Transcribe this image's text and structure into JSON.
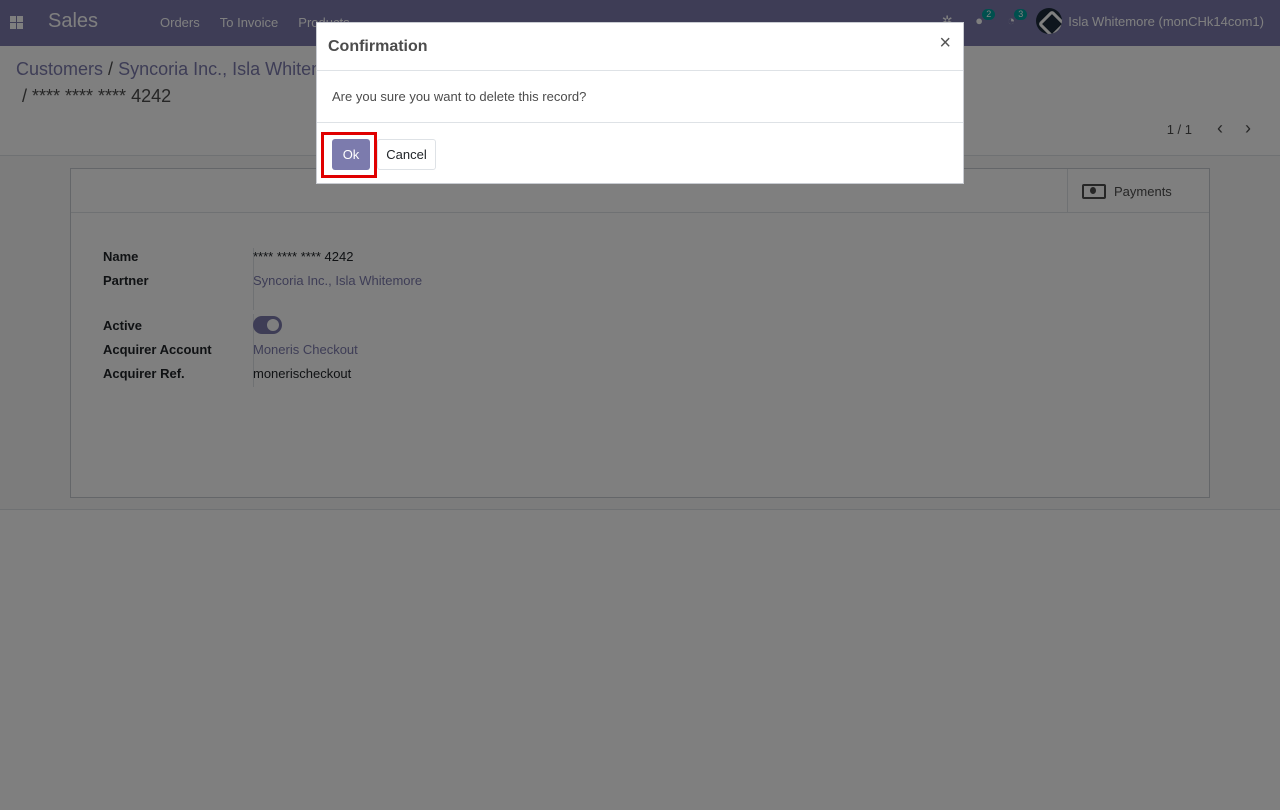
{
  "navbar": {
    "app_title": "Sales",
    "menu": [
      "Orders",
      "To Invoice",
      "Products"
    ],
    "messages_count": "2",
    "activities_count": "3",
    "user_name": "Isla Whitemore (monCHk14com1)"
  },
  "breadcrumb": {
    "items": [
      "Customers",
      "Syncoria Inc., Isla Whitemore"
    ],
    "separator": "/",
    "current": "/ **** **** **** 4242"
  },
  "pager": {
    "value": "1 / 1"
  },
  "sheet": {
    "payments_label": "Payments",
    "fields": {
      "name_label": "Name",
      "name_value": "**** **** **** 4242",
      "partner_label": "Partner",
      "partner_value": "Syncoria Inc., Isla Whitemore",
      "active_label": "Active",
      "active_value": true,
      "acquirer_label": "Acquirer Account",
      "acquirer_value": "Moneris Checkout",
      "acquirer_ref_label": "Acquirer Ref.",
      "acquirer_ref_value": "monerischeckout"
    }
  },
  "modal": {
    "title": "Confirmation",
    "close_glyph": "×",
    "message": "Are you sure you want to delete this record?",
    "ok_label": "Ok",
    "cancel_label": "Cancel"
  },
  "colors": {
    "brand": "#7c7bad",
    "highlight": "#e00000"
  }
}
